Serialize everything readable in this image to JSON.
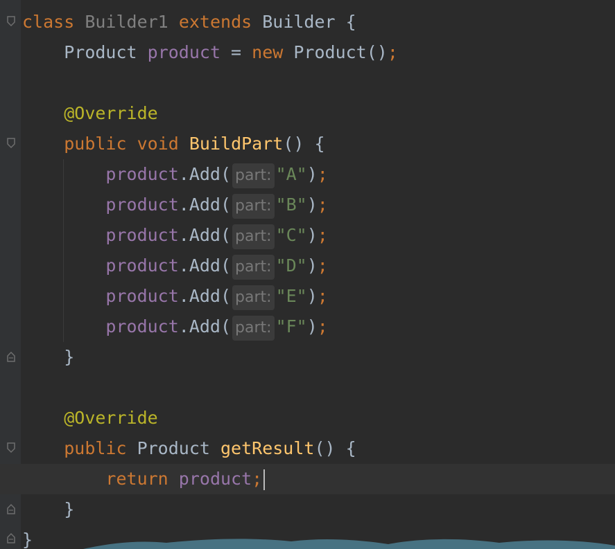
{
  "editor": {
    "lines": [
      {
        "indent": "",
        "tokens": [
          {
            "t": "class",
            "c": "kw"
          },
          {
            "t": " ",
            "c": ""
          },
          {
            "t": "Builder1",
            "c": "cls-dim"
          },
          {
            "t": " ",
            "c": ""
          },
          {
            "t": "extends",
            "c": "kw"
          },
          {
            "t": " Builder {",
            "c": ""
          }
        ]
      },
      {
        "indent": "    ",
        "tokens": [
          {
            "t": "Product ",
            "c": ""
          },
          {
            "t": "product",
            "c": "field"
          },
          {
            "t": " = ",
            "c": ""
          },
          {
            "t": "new",
            "c": "kw"
          },
          {
            "t": " Product()",
            "c": ""
          },
          {
            "t": ";",
            "c": "punct-or"
          }
        ]
      },
      {
        "indent": "",
        "tokens": []
      },
      {
        "indent": "    ",
        "tokens": [
          {
            "t": "@Override",
            "c": "ann"
          }
        ]
      },
      {
        "indent": "    ",
        "tokens": [
          {
            "t": "public",
            "c": "kw"
          },
          {
            "t": " ",
            "c": ""
          },
          {
            "t": "void",
            "c": "kw"
          },
          {
            "t": " ",
            "c": ""
          },
          {
            "t": "BuildPart",
            "c": "fn"
          },
          {
            "t": "() {",
            "c": ""
          }
        ]
      },
      {
        "indent": "        ",
        "call": true,
        "arg": "\"A\""
      },
      {
        "indent": "        ",
        "call": true,
        "arg": "\"B\""
      },
      {
        "indent": "        ",
        "call": true,
        "arg": "\"C\""
      },
      {
        "indent": "        ",
        "call": true,
        "arg": "\"D\""
      },
      {
        "indent": "        ",
        "call": true,
        "arg": "\"E\""
      },
      {
        "indent": "        ",
        "call": true,
        "arg": "\"F\""
      },
      {
        "indent": "    ",
        "tokens": [
          {
            "t": "}",
            "c": ""
          }
        ]
      },
      {
        "indent": "",
        "tokens": []
      },
      {
        "indent": "    ",
        "tokens": [
          {
            "t": "@Override",
            "c": "ann"
          }
        ]
      },
      {
        "indent": "    ",
        "tokens": [
          {
            "t": "public",
            "c": "kw"
          },
          {
            "t": " Product ",
            "c": ""
          },
          {
            "t": "getResult",
            "c": "fn"
          },
          {
            "t": "() {",
            "c": ""
          }
        ]
      },
      {
        "indent": "        ",
        "current": true,
        "tokens": [
          {
            "t": "return",
            "c": "kw"
          },
          {
            "t": " ",
            "c": ""
          },
          {
            "t": "product",
            "c": "field"
          },
          {
            "t": ";",
            "c": "punct-or"
          }
        ]
      },
      {
        "indent": "    ",
        "tokens": [
          {
            "t": "}",
            "c": ""
          }
        ]
      },
      {
        "indent": "",
        "tokens": [
          {
            "t": "}",
            "c": ""
          }
        ]
      }
    ],
    "call_template": {
      "receiver": "product",
      "method": ".Add(",
      "hint": "part:",
      "close": ")",
      "semi": ";"
    }
  },
  "icons": {
    "fold": "fold-marker-icon",
    "bulb": "lightbulb-icon"
  },
  "colors": {
    "background": "#2b2b2b",
    "keyword": "#cc7832",
    "field": "#9876aa",
    "annotation": "#bbb529",
    "method": "#ffc66d",
    "string": "#6a8759",
    "text": "#a9b7c6",
    "bulb": "#f0c040",
    "wave": "#4a7a8c"
  }
}
